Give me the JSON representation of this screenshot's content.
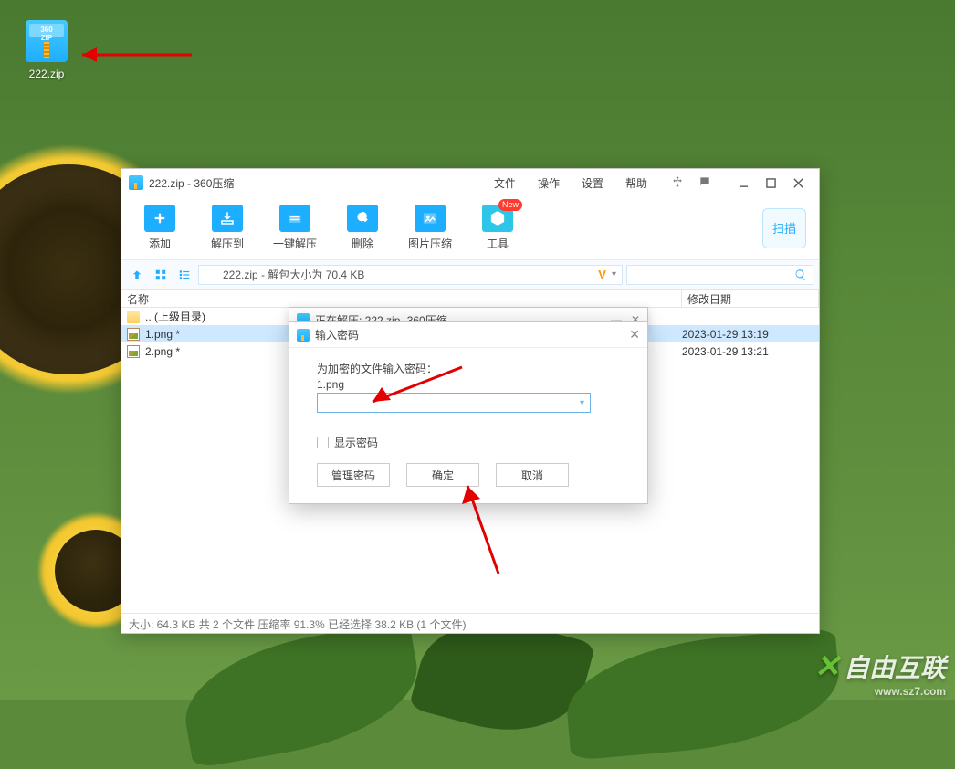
{
  "desktop": {
    "icon_label": "222.zip"
  },
  "main": {
    "title": "222.zip - 360压缩",
    "menu": {
      "file": "文件",
      "action": "操作",
      "settings": "设置",
      "help": "帮助"
    },
    "toolbar": {
      "add": "添加",
      "extract_to": "解压到",
      "one_click": "一键解压",
      "delete": "删除",
      "image_compress": "图片压缩",
      "tools": "工具",
      "tools_badge": "New",
      "scan": "扫描"
    },
    "path": "222.zip - 解包大小为 70.4 KB",
    "path_v": "V",
    "columns": {
      "name": "名称",
      "date": "修改日期"
    },
    "rows": {
      "up": ".. (上级目录)",
      "r1_name": "1.png *",
      "r1_date": "2023-01-29 13:19",
      "r2_name": "2.png *",
      "r2_date": "2023-01-29 13:21"
    },
    "status": "大小: 64.3 KB 共 2 个文件 压缩率 91.3% 已经选择 38.2 KB (1 个文件)"
  },
  "extract": {
    "title": "正在解压: 222.zip -360压缩"
  },
  "pwd": {
    "title": "输入密码",
    "prompt": "为加密的文件输入密码：",
    "filename": "1.png",
    "show_password": "显示密码",
    "btn_manage": "管理密码",
    "btn_ok": "确定",
    "btn_cancel": "取消"
  },
  "watermark": {
    "main": "自由互联",
    "sub": "www.sz7.com"
  }
}
